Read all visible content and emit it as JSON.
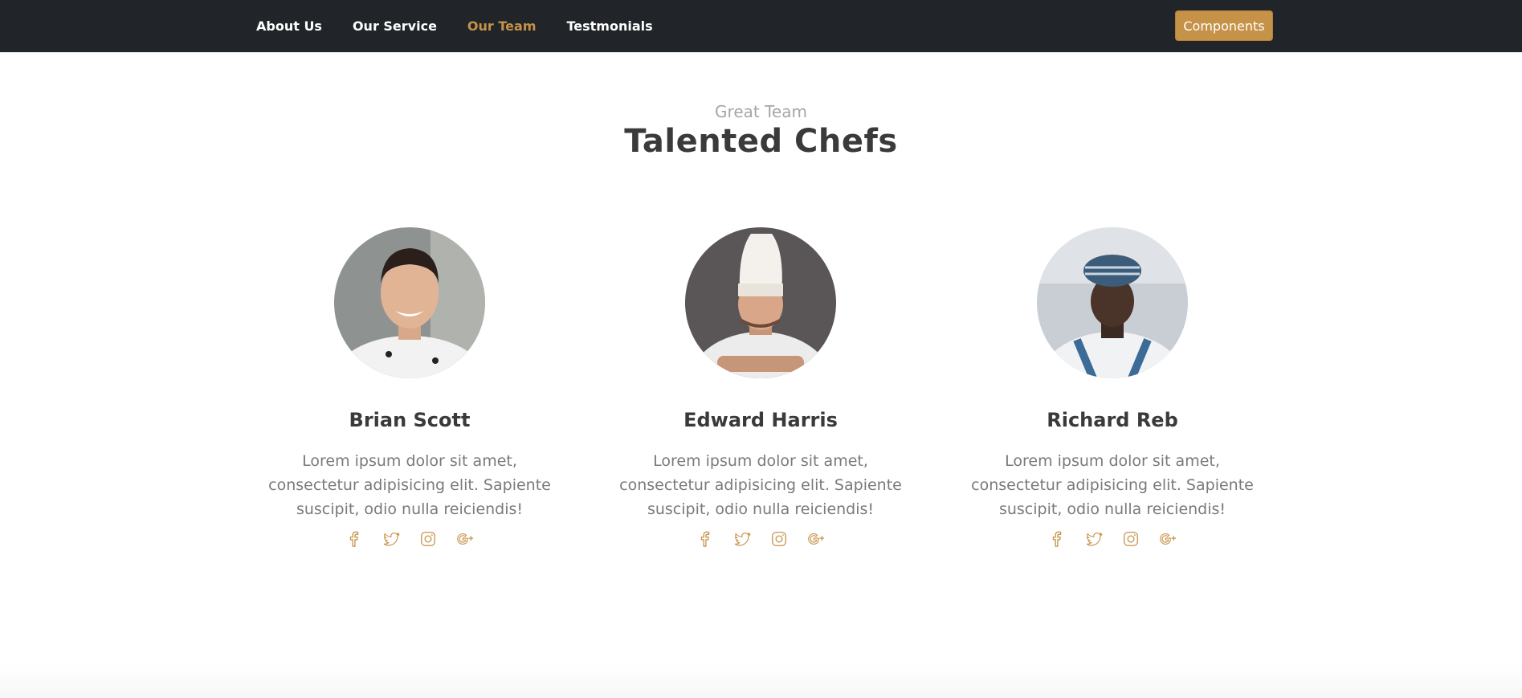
{
  "nav": {
    "links": [
      {
        "label": "About Us"
      },
      {
        "label": "Our Service"
      },
      {
        "label": "Our Team"
      },
      {
        "label": "Testmonials"
      }
    ],
    "cta_label": "Components"
  },
  "section": {
    "subheading": "Great Team",
    "heading": "Talented Chefs"
  },
  "members": [
    {
      "name": "Brian Scott",
      "bio": "Lorem ipsum dolor sit amet, consectetur adipisicing elit. Sapiente suscipit, odio nulla reiciendis!"
    },
    {
      "name": "Edward Harris",
      "bio": "Lorem ipsum dolor sit amet, consectetur adipisicing elit. Sapiente suscipit, odio nulla reiciendis!"
    },
    {
      "name": "Richard Reb",
      "bio": "Lorem ipsum dolor sit amet, consectetur adipisicing elit. Sapiente suscipit, odio nulla reiciendis!"
    }
  ],
  "social_icons": [
    "facebook-icon",
    "twitter-icon",
    "instagram-icon",
    "google-plus-icon"
  ],
  "colors": {
    "accent": "#c69248",
    "nav_bg": "#212529"
  }
}
